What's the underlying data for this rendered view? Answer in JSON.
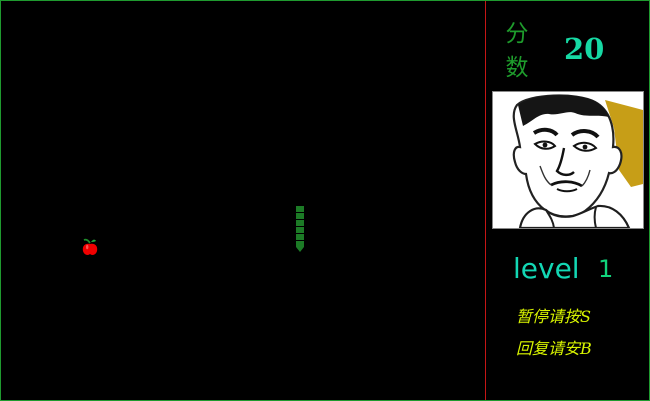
{
  "panel": {
    "score_label": "分\n数",
    "score_value": "20",
    "level_label": "level",
    "level_value": "1",
    "pause_hint": "暂停请按S",
    "resume_hint": "回复请安B"
  },
  "game": {
    "apple": "red-apple",
    "snake_color": "#1c7b26",
    "apple_color": "#f00000",
    "divider_color": "#c51616",
    "frame_color": "#1f9a2f"
  },
  "portrait": {
    "subject": "cartoon-face"
  }
}
